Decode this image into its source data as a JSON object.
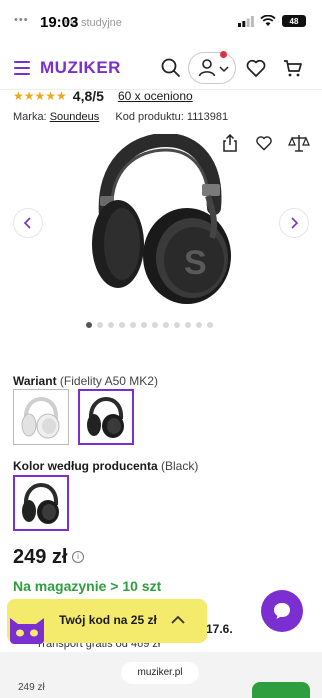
{
  "status_bar": {
    "time": "19:03",
    "ghost_text": "wki studyjne",
    "battery": "48"
  },
  "header": {
    "logo": "MUZIKER"
  },
  "product": {
    "rating_score": "4,8/5",
    "rating_count": "60 x oceniono",
    "brand_label": "Marka:",
    "brand": "Soundeus",
    "code_label": "Kod produktu:",
    "code": "1113981",
    "image_count": 12,
    "active_image": 0,
    "variant_heading": "Wariant",
    "variant_value": "(Fidelity A50 MK2)",
    "color_heading": "Kolor według producenta",
    "color_value": "(Black)",
    "price": "249 zł",
    "price_info": "i",
    "stock": "Na magazynie > 10 szt"
  },
  "obscured": {
    "delivery_date": "17.6.",
    "shipping": "Transport gratis od 469 zł"
  },
  "promo": {
    "text": "Twój kod na 25 zł"
  },
  "browser": {
    "url": "muziker.pl",
    "bottom_price": "249 zł"
  },
  "colors": {
    "brand": "#7b2fd0",
    "stock": "#2e9e3e",
    "promo": "#f4ea6c",
    "stars": "#f0a81a"
  },
  "icons": [
    "hamburger-icon",
    "search-icon",
    "user-icon",
    "heart-icon",
    "cart-icon",
    "share-icon",
    "compare-icon",
    "chat-icon",
    "chevron-up-icon",
    "info-icon"
  ]
}
